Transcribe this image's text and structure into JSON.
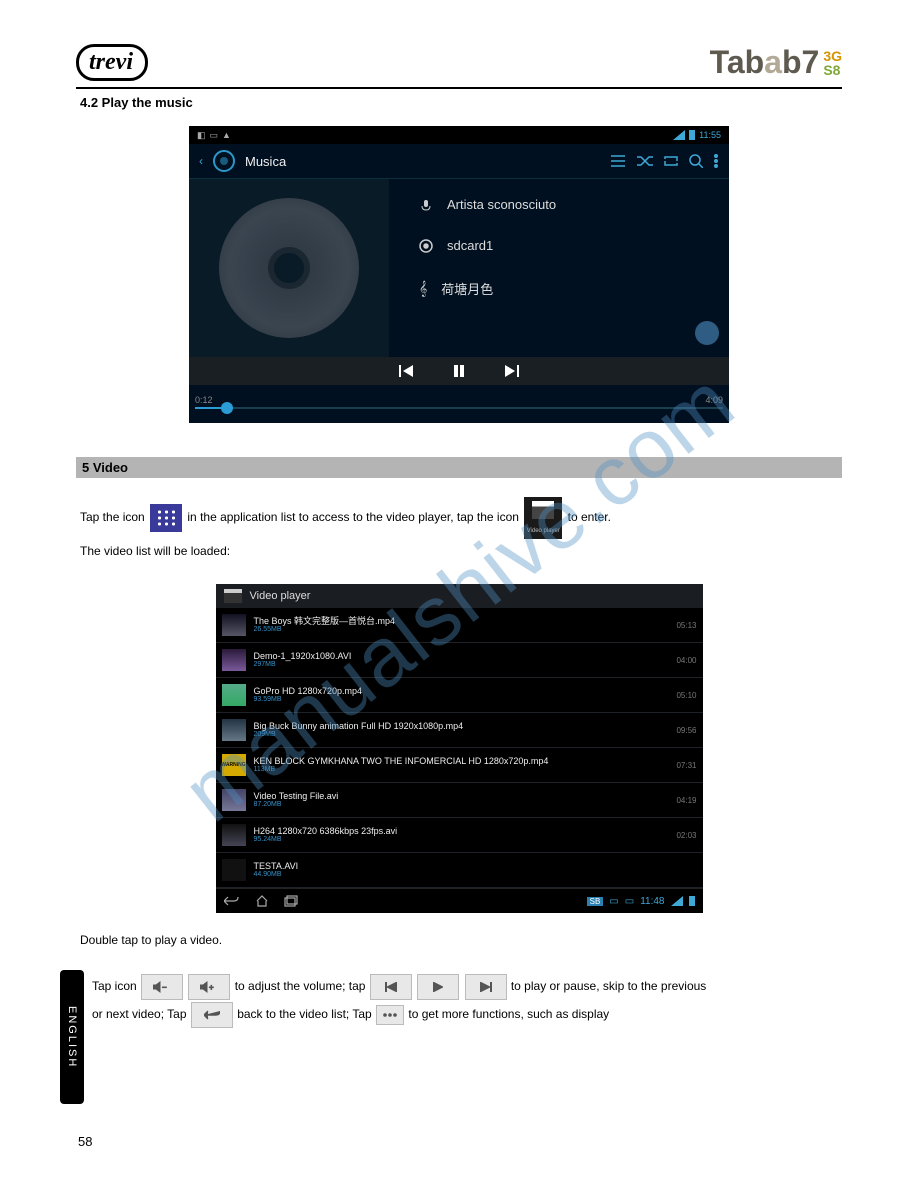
{
  "header": {
    "brand": "trevi",
    "product_prefix": "Tab",
    "product_num": "7",
    "suffix_top": "3G",
    "suffix_bottom": "S8"
  },
  "sec_sub": "4.2 Play the music",
  "music": {
    "title": "Musica",
    "artist_label": "Artista sconosciuto",
    "album_label": "sdcard1",
    "track_label": "荷塘月色",
    "time_elapsed": "0:12",
    "time_total": "4:09",
    "status_time": "11:55"
  },
  "video_section": {
    "heading": "5 Video",
    "line1_a": "Tap the icon ",
    "line1_b": " in the application list to access to the video player, tap the icon ",
    "line1_c": " to enter.",
    "line2": "The video list will be loaded:",
    "app_icon_label": "Video player"
  },
  "videoplayer": {
    "title": "Video player",
    "items": [
      {
        "name": "The Boys 韩文完整版—首悦台.mp4",
        "size": "26.55MB",
        "dur": "05:13"
      },
      {
        "name": "Demo-1_1920x1080.AVI",
        "size": "297MB",
        "dur": "04:00"
      },
      {
        "name": "GoPro HD 1280x720p.mp4",
        "size": "93.59MB",
        "dur": "05:10"
      },
      {
        "name": "Big Buck Bunny animation Full HD 1920x1080p.mp4",
        "size": "209MB",
        "dur": "09:56"
      },
      {
        "name": "KEN BLOCK GYMKHANA TWO THE INFOMERCIAL HD 1280x720p.mp4",
        "size": "113MB",
        "dur": "07:31"
      },
      {
        "name": "Video Testing File.avi",
        "size": "87.20MB",
        "dur": "04:19"
      },
      {
        "name": "H264 1280x720 6386kbps 23fps.avi",
        "size": "95.24MB",
        "dur": "02:03"
      },
      {
        "name": "TESTA.AVI",
        "size": "44.90MB",
        "dur": ""
      }
    ],
    "warn": "WARNING",
    "sb_badge": "SB",
    "clock": "11:48"
  },
  "after_list": "Double tap to play a video.",
  "english": {
    "tab": "ENGLISH",
    "l1_a": "Tap icon ",
    "l1_b": " to adjust the volume; tap ",
    "l1_c": " to play or pause, skip to the previous",
    "l2_a": "or next video; Tap ",
    "l2_b": " back to the video list; Tap ",
    "l2_c": " to get more functions, such as display"
  },
  "page_num": "58",
  "watermark": "manualshive.com"
}
